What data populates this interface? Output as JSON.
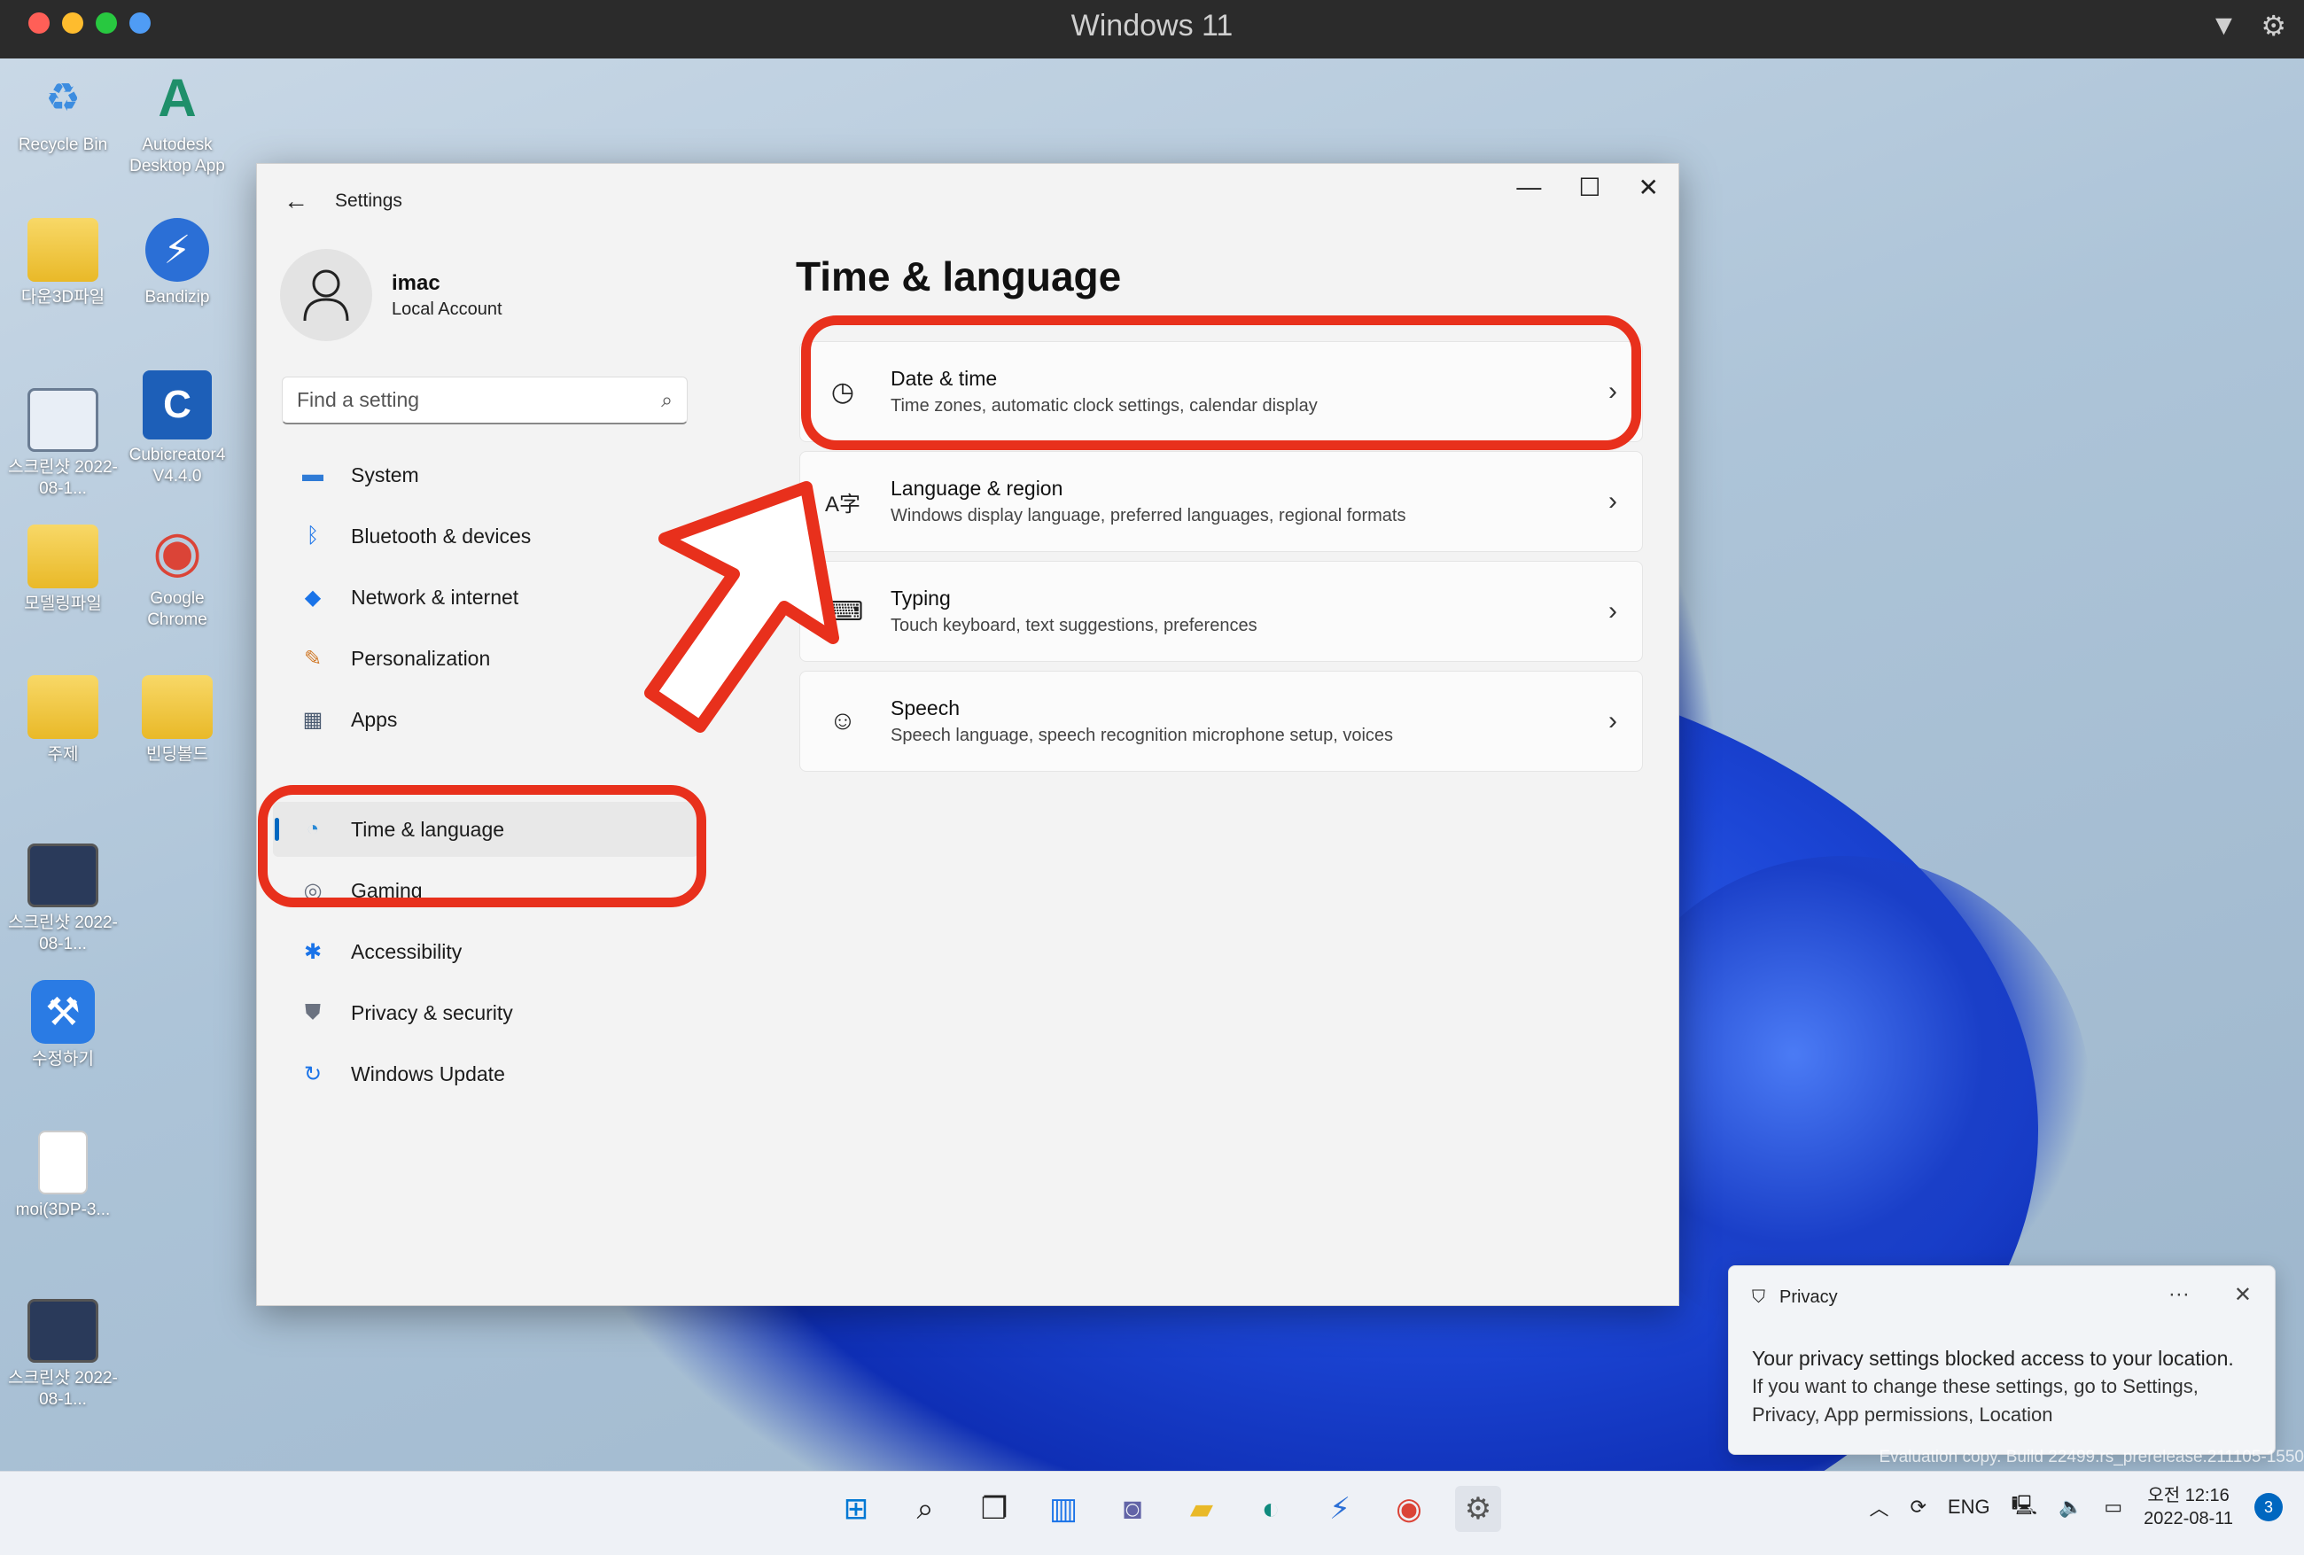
{
  "host": {
    "title": "Windows 11",
    "traffic_colors": [
      "#ff5f57",
      "#febc2e",
      "#28c840",
      "#4f9cf5"
    ]
  },
  "desktop": {
    "icons": [
      {
        "label": "Recycle Bin",
        "icon": "recycle-bin-icon",
        "glyph": "♻"
      },
      {
        "label": "Autodesk Desktop App",
        "icon": "autodesk-icon",
        "glyph": "A"
      },
      {
        "label": "다운3D파일",
        "icon": "folder-icon",
        "glyph": ""
      },
      {
        "label": "Bandizip",
        "icon": "bandizip-icon",
        "glyph": "⚡"
      },
      {
        "label": "스크린샷 2022-08-1...",
        "icon": "screenshot-thumbnail-icon",
        "glyph": ""
      },
      {
        "label": "Cubicreator4 V4.4.0",
        "icon": "cubicreator-icon",
        "glyph": "C"
      },
      {
        "label": "모델링파일",
        "icon": "folder-icon",
        "glyph": ""
      },
      {
        "label": "Google Chrome",
        "icon": "chrome-icon",
        "glyph": "◉"
      },
      {
        "label": "주제",
        "icon": "folder-icon",
        "glyph": ""
      },
      {
        "label": "빈딩볼드",
        "icon": "folder-icon",
        "glyph": ""
      },
      {
        "label": "스크린샷 2022-08-1...",
        "icon": "screenshot-thumbnail-icon",
        "glyph": ""
      },
      {
        "label": "수정하기",
        "icon": "xcode-icon",
        "glyph": "⚒"
      },
      {
        "label": "moi(3DP-3...",
        "icon": "file-icon",
        "glyph": ""
      },
      {
        "label": "스크린샷 2022-08-1...",
        "icon": "screenshot-thumbnail-icon",
        "glyph": ""
      }
    ]
  },
  "settings": {
    "window_title": "Settings",
    "account": {
      "name": "imac",
      "type": "Local Account"
    },
    "search": {
      "placeholder": "Find a setting"
    },
    "nav": [
      {
        "label": "System",
        "icon": "system-icon",
        "glyph": "▬",
        "color": "#2f7bd6"
      },
      {
        "label": "Bluetooth & devices",
        "icon": "bluetooth-icon",
        "glyph": "ᛒ",
        "color": "#1a73e8"
      },
      {
        "label": "Network & internet",
        "icon": "wifi-icon",
        "glyph": "◆",
        "color": "#1a73e8"
      },
      {
        "label": "Personalization",
        "icon": "brush-icon",
        "glyph": "✎",
        "color": "#d07a2a"
      },
      {
        "label": "Apps",
        "icon": "apps-icon",
        "glyph": "▦",
        "color": "#4a5a70"
      },
      {
        "label": "Time & language",
        "icon": "globe-clock-icon",
        "glyph": "◔",
        "color": "#2a8ad6"
      },
      {
        "label": "Gaming",
        "icon": "gaming-icon",
        "glyph": "◎",
        "color": "#6b7280"
      },
      {
        "label": "Accessibility",
        "icon": "accessibility-icon",
        "glyph": "✱",
        "color": "#1a73e8"
      },
      {
        "label": "Privacy & security",
        "icon": "shield-icon",
        "glyph": "⛊",
        "color": "#6b7280"
      },
      {
        "label": "Windows Update",
        "icon": "update-icon",
        "glyph": "↻",
        "color": "#1a73e8"
      }
    ],
    "page_title": "Time & language",
    "cards": [
      {
        "title": "Date & time",
        "subtitle": "Time zones, automatic clock settings, calendar display",
        "icon": "calendar-clock-icon",
        "glyph": "◷"
      },
      {
        "title": "Language & region",
        "subtitle": "Windows display language, preferred languages, regional formats",
        "icon": "language-icon",
        "glyph": "A字"
      },
      {
        "title": "Typing",
        "subtitle": "Touch keyboard, text suggestions, preferences",
        "icon": "keyboard-icon",
        "glyph": "⌨"
      },
      {
        "title": "Speech",
        "subtitle": "Speech language, speech recognition microphone setup, voices",
        "icon": "speech-icon",
        "glyph": "☺"
      }
    ]
  },
  "annotation": {
    "color": "#e8301c"
  },
  "toast": {
    "title": "Privacy",
    "line1": "Your privacy settings blocked access to your location.",
    "line2": "If you want to change these settings, go to Settings, Privacy, App permissions, Location",
    "more": "···",
    "close": "✕"
  },
  "watermark": "Evaluation copy. Build 22499.rs_prerelease.211105-1550",
  "taskbar": {
    "apps": [
      {
        "icon": "start-icon",
        "glyph": "⊞",
        "color": "#0078d4"
      },
      {
        "icon": "search-icon",
        "glyph": "⌕",
        "color": "#222"
      },
      {
        "icon": "task-view-icon",
        "glyph": "❐",
        "color": "#222"
      },
      {
        "icon": "widgets-icon",
        "glyph": "▥",
        "color": "#1a73e8"
      },
      {
        "icon": "teams-chat-icon",
        "glyph": "◙",
        "color": "#6264a7"
      },
      {
        "icon": "file-explorer-icon",
        "glyph": "▰",
        "color": "#e9b928"
      },
      {
        "icon": "edge-icon",
        "glyph": "◐",
        "color": "#0f8a7e"
      },
      {
        "icon": "bandizip-taskbar-icon",
        "glyph": "⚡",
        "color": "#2b6fd6"
      },
      {
        "icon": "chrome-taskbar-icon",
        "glyph": "◉",
        "color": "#db4437"
      },
      {
        "icon": "settings-taskbar-icon",
        "glyph": "⚙",
        "color": "#555"
      }
    ],
    "lang": "ENG",
    "time": "오전 12:16",
    "date": "2022-08-11",
    "notification_count": "3"
  }
}
